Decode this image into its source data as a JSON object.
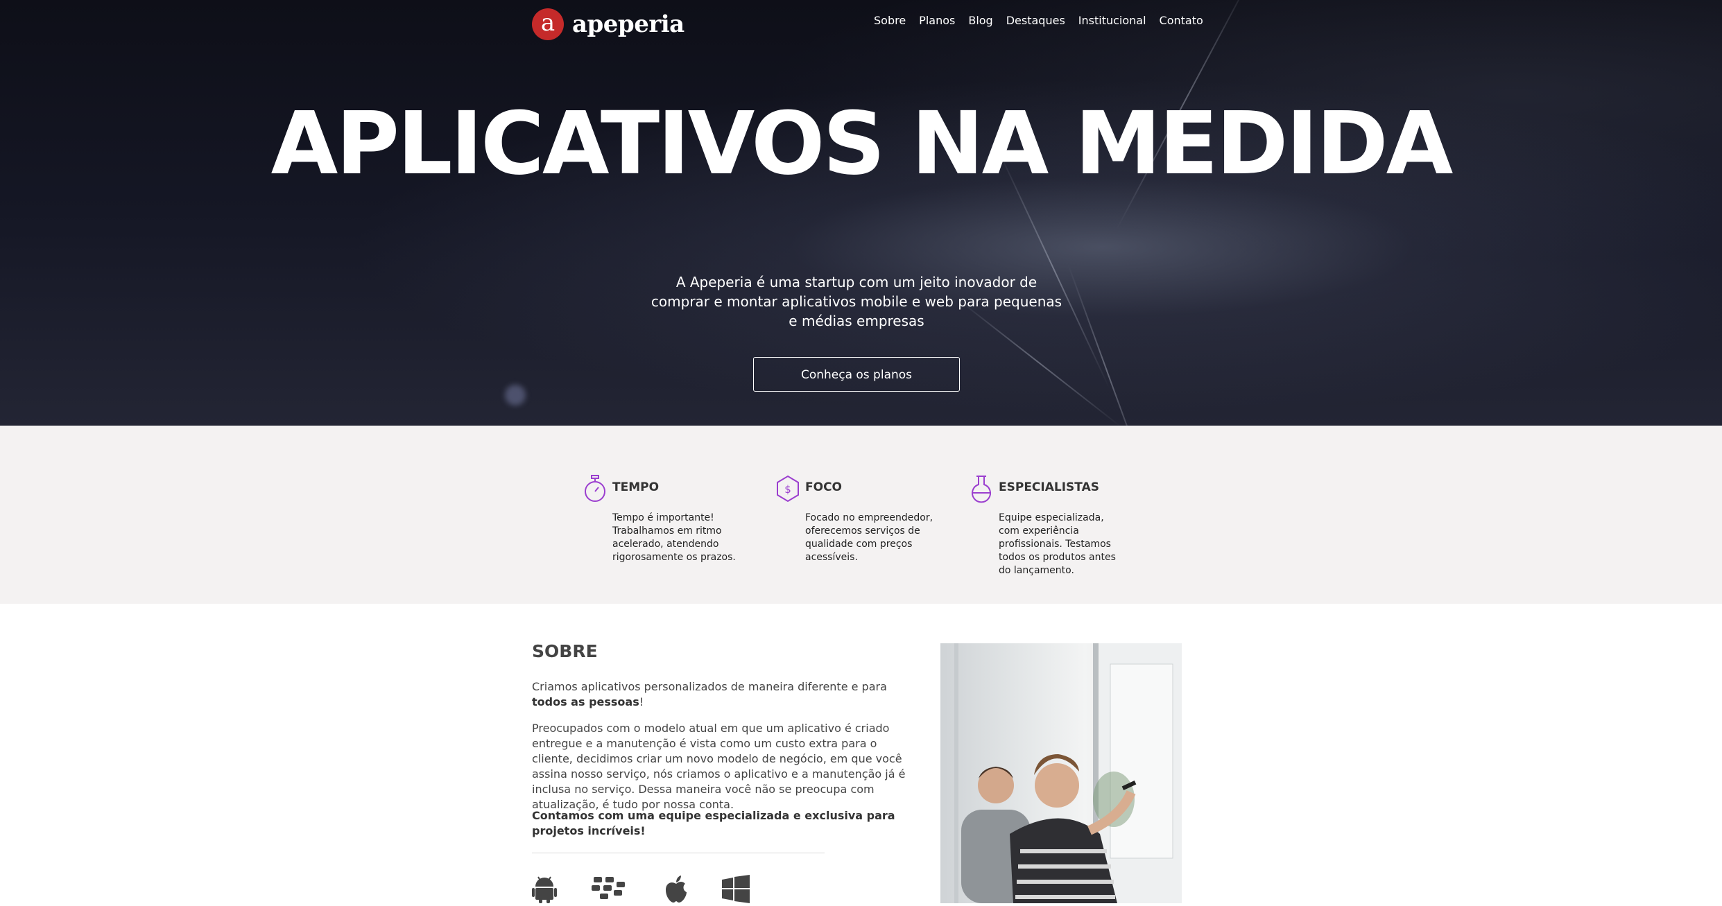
{
  "brand": {
    "logo_mark": "a",
    "name": "apeperia",
    "logo_color": "#c52a2a"
  },
  "nav": [
    "Sobre",
    "Planos",
    "Blog",
    "Destaques",
    "Institucional",
    "Contato"
  ],
  "hero": {
    "title": "APLICATIVOS NA MEDIDA",
    "subtitle": "A Apeperia é uma startup com um jeito inovador de comprar e montar aplicativos mobile e web para pequenas e médias empresas",
    "cta": "Conheça os planos"
  },
  "features": [
    {
      "icon": "stopwatch-icon",
      "title": "TEMPO",
      "text": "Tempo é importante! Trabalhamos em ritmo acelerado, atendendo rigorosamente os prazos."
    },
    {
      "icon": "dollar-hexagon-icon",
      "title": "FOCO",
      "text": "Focado no empreendedor, oferecemos serviços de qualidade com preços acessíveis."
    },
    {
      "icon": "flask-icon",
      "title": "ESPECIALISTAS",
      "text": "Equipe especializada, com experiência profissionais. Testamos todos os produtos antes do lançamento."
    }
  ],
  "about": {
    "title": "SOBRE",
    "p1_before": "Criamos aplicativos personalizados de maneira diferente e para ",
    "p1_bold": "todos as pessoas",
    "p1_after": "!",
    "p2": "Preocupados com o modelo atual em que um aplicativo é criado entregue e a manutenção é vista como um custo extra para o cliente, decidimos criar um novo modelo de negócio, em que você assina nosso serviço, nós criamos o aplicativo e a manutenção já é inclusa no serviço. Dessa maneira você não se preocupa com atualização, é tudo por nossa conta.",
    "p3": "Contamos com uma equipe especializada e exclusiva para projetos incríveis!"
  },
  "platform_icons": [
    "android-icon",
    "blackberry-icon",
    "apple-icon",
    "windows-icon"
  ],
  "colors": {
    "accent": "#9b3fcf",
    "features_bg": "#f4f2f2"
  }
}
